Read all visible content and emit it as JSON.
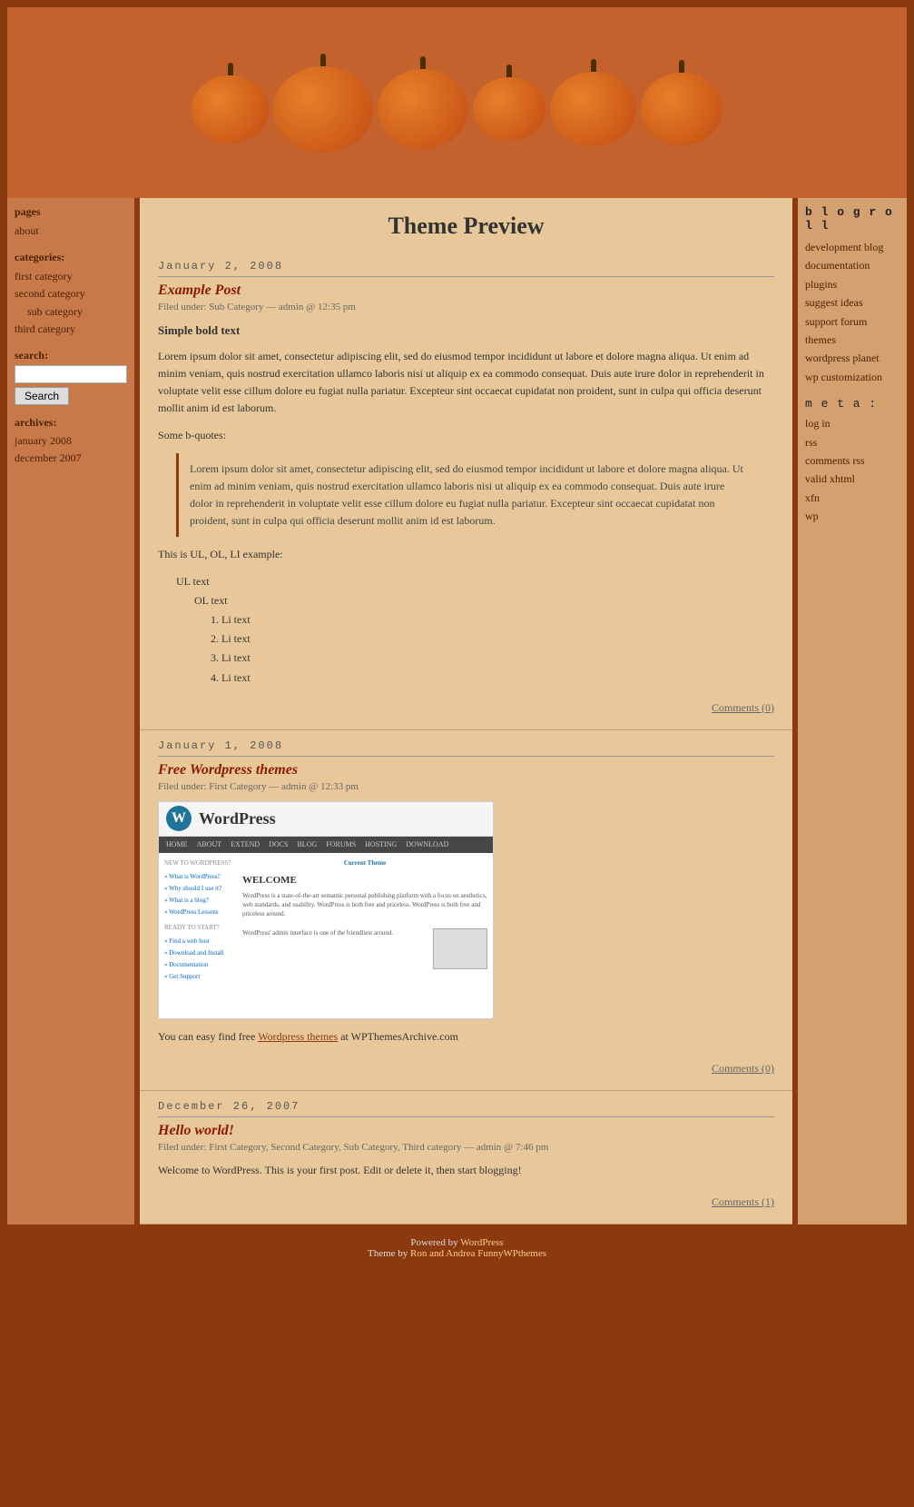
{
  "site": {
    "title": "Theme Preview"
  },
  "header": {
    "image_alt": "Pumpkins header image"
  },
  "sidebar": {
    "pages_label": "pages",
    "pages": [
      {
        "label": "about",
        "href": "#"
      }
    ],
    "categories_label": "categories:",
    "categories": [
      {
        "label": "first category",
        "href": "#",
        "sub": false
      },
      {
        "label": "second category",
        "href": "#",
        "sub": false
      },
      {
        "label": "sub category",
        "href": "#",
        "sub": true
      },
      {
        "label": "third category",
        "href": "#",
        "sub": false
      }
    ],
    "search_label": "search:",
    "search_placeholder": "",
    "search_button": "Search",
    "archives_label": "archives:",
    "archives": [
      {
        "label": "january 2008",
        "href": "#"
      },
      {
        "label": "december 2007",
        "href": "#"
      }
    ]
  },
  "blogroll": {
    "title": "b l o g r o l l",
    "links": [
      {
        "label": "development blog",
        "href": "#"
      },
      {
        "label": "documentation",
        "href": "#"
      },
      {
        "label": "plugins",
        "href": "#"
      },
      {
        "label": "suggest ideas",
        "href": "#"
      },
      {
        "label": "support forum",
        "href": "#"
      },
      {
        "label": "themes",
        "href": "#"
      },
      {
        "label": "wordpress planet",
        "href": "#"
      },
      {
        "label": "wp customization",
        "href": "#"
      }
    ],
    "meta_title": "m e t a :",
    "meta_links": [
      {
        "label": "log in",
        "href": "#"
      },
      {
        "label": "rss",
        "href": "#"
      },
      {
        "label": "comments rss",
        "href": "#"
      },
      {
        "label": "valid xhtml",
        "href": "#"
      },
      {
        "label": "xfn",
        "href": "#"
      },
      {
        "label": "wp",
        "href": "#"
      }
    ]
  },
  "posts": [
    {
      "date": "January 2, 2008",
      "title": "Example Post",
      "meta": "Filed under: Sub Category — admin @ 12:35 pm",
      "bold_text": "Simple bold text",
      "paragraph": "Lorem ipsum dolor sit amet, consectetur adipiscing elit, sed do eiusmod tempor incididunt ut labore et dolore magna aliqua. Ut enim ad minim veniam, quis nostrud exercitation ullamco laboris nisi ut aliquip ex ea commodo consequat. Duis aute irure dolor in reprehenderit in voluptate velit esse cillum dolore eu fugiat nulla pariatur. Excepteur sint occaecat cupidatat non proident, sunt in culpa qui officia deserunt mollit anim id est laborum.",
      "blockquote_label": "Some b-quotes:",
      "blockquote": "Lorem ipsum dolor sit amet, consectetur adipiscing elit, sed do eiusmod tempor incididunt ut labore et dolore magna aliqua. Ut enim ad minim veniam, quis nostrud exercitation ullamco laboris nisi ut aliquip ex ea commodo consequat. Duis aute irure dolor in reprehenderit in voluptate velit esse cillum dolore eu fugiat nulla pariatur. Excepteur sint occaecat cupidatat non proident, sunt in culpa qui officia deserunt mollit anim id est laborum.",
      "list_label": "This is UL, OL, LI example:",
      "ul_text": "UL text",
      "ol_text": "OL text",
      "li_items": [
        "Li text",
        "Li text",
        "Li text",
        "Li text"
      ],
      "comments": "Comments (0)"
    },
    {
      "date": "January 1, 2008",
      "title": "Free Wordpress themes",
      "meta": "Filed under: First Category — admin @ 12:33 pm",
      "paragraph": "You can easy find free Wordpress themes at WPThemesArchive.com",
      "has_screenshot": true,
      "comments": "Comments (0)"
    },
    {
      "date": "December 26, 2007",
      "title": "Hello world!",
      "meta": "Filed under: First Category, Second Category, Sub Category, Third category — admin @ 7:46 pm",
      "paragraph": "Welcome to WordPress. This is your first post. Edit or delete it, then start blogging!",
      "comments": "Comments (1)"
    }
  ],
  "footer": {
    "powered_by": "Powered by",
    "wordpress_link": "WordPress",
    "theme_text": "Theme by",
    "theme_author": "Ron and Andrea FunnyWPthemes"
  }
}
